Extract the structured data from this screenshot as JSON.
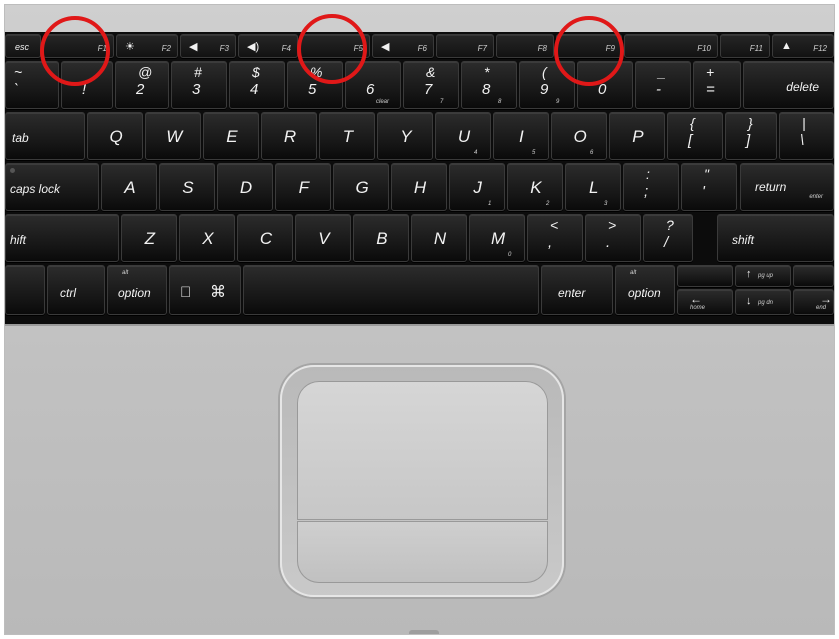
{
  "keyboard": {
    "function_row": [
      {
        "label": "esc",
        "fn": ""
      },
      {
        "label": "",
        "fn": "F1"
      },
      {
        "label": "☀",
        "fn": "F2"
      },
      {
        "label": "◀",
        "fn": "F3"
      },
      {
        "label": "◀)",
        "fn": "F4"
      },
      {
        "label": "",
        "fn": "F5"
      },
      {
        "label": "◀",
        "fn": "F6"
      },
      {
        "label": "",
        "fn": "F7"
      },
      {
        "label": "",
        "fn": "F8"
      },
      {
        "label": "",
        "fn": "F9"
      },
      {
        "label": "",
        "fn": "F10"
      },
      {
        "label": "",
        "fn": "F11"
      },
      {
        "label": "▲",
        "fn": "F12"
      }
    ],
    "number_row": [
      {
        "top": "~",
        "bot": "`",
        "sub": ""
      },
      {
        "top": "",
        "bot": "!",
        "sub": ""
      },
      {
        "top": "@",
        "bot": "2",
        "sub": ""
      },
      {
        "top": "#",
        "bot": "3",
        "sub": ""
      },
      {
        "top": "$",
        "bot": "4",
        "sub": ""
      },
      {
        "top": "%",
        "bot": "5",
        "sub": ""
      },
      {
        "top": "",
        "bot": "6",
        "sub": "clear"
      },
      {
        "top": "&",
        "bot": "7",
        "sub": "7"
      },
      {
        "top": "*",
        "bot": "8",
        "sub": "8"
      },
      {
        "top": "(",
        "bot": "9",
        "sub": "9"
      },
      {
        "top": "",
        "bot": "0",
        "sub": ""
      },
      {
        "top": "_",
        "bot": "-",
        "sub": ""
      },
      {
        "top": "+",
        "bot": "=",
        "sub": ""
      }
    ],
    "delete": "delete",
    "qwerty_row": [
      {
        "key": "Q",
        "sub": ""
      },
      {
        "key": "W",
        "sub": ""
      },
      {
        "key": "E",
        "sub": ""
      },
      {
        "key": "R",
        "sub": ""
      },
      {
        "key": "T",
        "sub": ""
      },
      {
        "key": "Y",
        "sub": ""
      },
      {
        "key": "U",
        "sub": "4"
      },
      {
        "key": "I",
        "sub": "5"
      },
      {
        "key": "O",
        "sub": "6"
      },
      {
        "key": "P",
        "sub": ""
      }
    ],
    "qwerty_extra": [
      {
        "top": "{",
        "bot": "["
      },
      {
        "top": "}",
        "bot": "]"
      },
      {
        "top": "|",
        "bot": "\\"
      }
    ],
    "tab": "tab",
    "asdf_row": [
      {
        "key": "A",
        "sub": ""
      },
      {
        "key": "S",
        "sub": ""
      },
      {
        "key": "D",
        "sub": ""
      },
      {
        "key": "F",
        "sub": ""
      },
      {
        "key": "G",
        "sub": ""
      },
      {
        "key": "H",
        "sub": ""
      },
      {
        "key": "J",
        "sub": "1"
      },
      {
        "key": "K",
        "sub": "2"
      },
      {
        "key": "L",
        "sub": "3"
      }
    ],
    "asdf_extra": [
      {
        "top": ":",
        "bot": ";"
      },
      {
        "top": "\"",
        "bot": "'"
      }
    ],
    "caps_lock": "caps lock",
    "return": "return",
    "return_sub": "enter",
    "zxcv_row": [
      {
        "key": "Z",
        "sub": ""
      },
      {
        "key": "X",
        "sub": ""
      },
      {
        "key": "C",
        "sub": ""
      },
      {
        "key": "V",
        "sub": ""
      },
      {
        "key": "B",
        "sub": ""
      },
      {
        "key": "N",
        "sub": ""
      },
      {
        "key": "M",
        "sub": "0"
      }
    ],
    "zxcv_extra": [
      {
        "top": "<",
        "bot": ","
      },
      {
        "top": ">",
        "bot": "."
      },
      {
        "top": "?",
        "bot": "/"
      }
    ],
    "shift_left": "hift",
    "shift_right": "shift",
    "bottom_row": {
      "ctrl": "ctrl",
      "option_left": "option",
      "alt_left": "alt",
      "apple": "",
      "command": "⌘",
      "enter": "enter",
      "option_right": "option",
      "alt_right": "alt",
      "pg_up": "pg up",
      "pg_dn": "pg dn",
      "home": "home",
      "end": "end",
      "arrow_up": "↑",
      "arrow_down": "↓",
      "arrow_left": "←",
      "arrow_right": "→"
    }
  },
  "markers": {
    "color": "#e01818",
    "count": 3
  },
  "colors": {
    "keys": "#151515",
    "case": "#c4c4c4"
  }
}
